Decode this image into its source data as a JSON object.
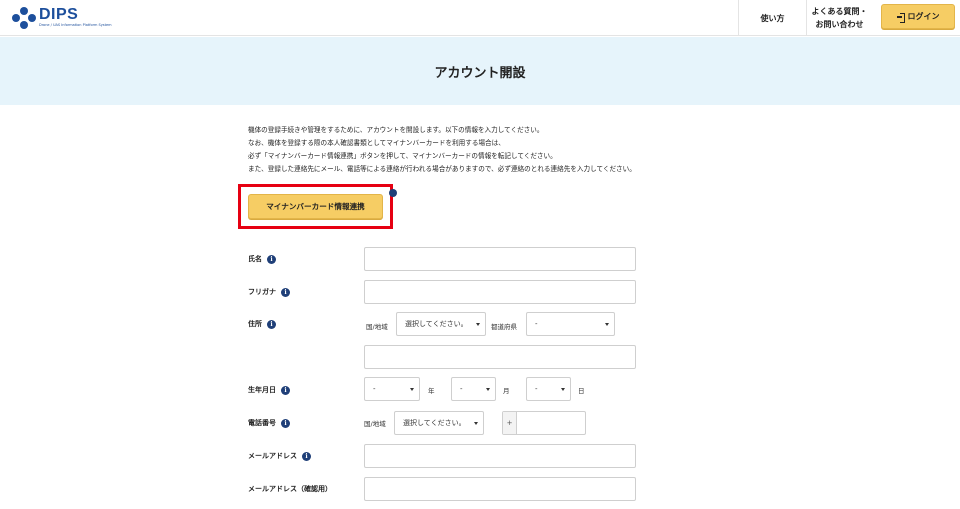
{
  "header": {
    "logo_text": "DIPS",
    "logo_sub": "Drone / UAS Information Platform System",
    "nav_usage": "使い方",
    "nav_faq": "よくある質問・\nお問い合わせ",
    "login": "ログイン"
  },
  "page": {
    "title": "アカウント開設",
    "intro": [
      "機体の登録手続きや管理をするために、アカウントを開設します。以下の情報を入力してください。",
      "なお、機体を登録する際の本人確認書類としてマイナンバーカードを利用する場合は、",
      "必ず「マイナンバーカード情報連携」ボタンを押して、マイナンバーカードの情報を転記してください。",
      "また、登録した連絡先にメール、電話等による連絡が行われる場合がありますので、必ず連絡のとれる連絡先を入力してください。"
    ],
    "mynumber_button": "マイナンバーカード情報連携"
  },
  "form": {
    "name_label": "氏名",
    "furigana_label": "フリガナ",
    "address_label": "住所",
    "country_label": "国/地域",
    "country_select": "選択してください。",
    "prefecture_label": "都道府県",
    "prefecture_select": "-",
    "birthdate_label": "生年月日",
    "year_select": "-",
    "year_unit": "年",
    "month_select": "-",
    "month_unit": "月",
    "day_select": "-",
    "day_unit": "日",
    "phone_label": "電話番号",
    "phone_country_label": "国/地域",
    "phone_country_select": "選択してください。",
    "phone_plus": "+",
    "email_label": "メールアドレス",
    "email_confirm_label": "メールアドレス（確認用）",
    "info_glyph": "i"
  },
  "colors": {
    "accent_button": "#f6cd64",
    "banner_bg": "#e6f4fb",
    "info_icon": "#1f3f78",
    "highlight": "#e60012",
    "brand": "#1d4f9c"
  }
}
